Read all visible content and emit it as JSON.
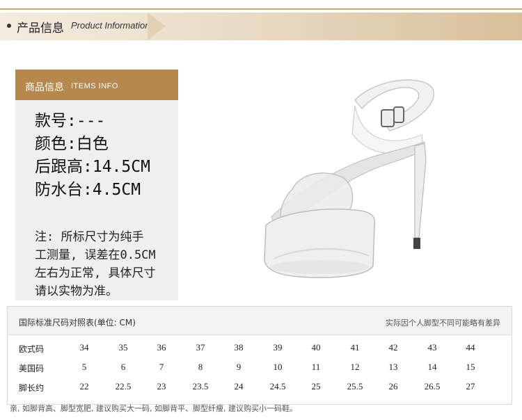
{
  "header": {
    "title_cn": "产品信息",
    "title_en": "Product Information"
  },
  "info": {
    "header_cn": "商品信息",
    "header_en": "ITEMS INFO",
    "specs": [
      "款号:---",
      "颜色:白色",
      "后跟高:14.5CM",
      "防水台:4.5CM"
    ],
    "note_lines": [
      "注: 所标尺寸为纯手",
      "工测量, 误差在0.5CM",
      "左右为正常, 具体尺寸",
      "请以实物为准。"
    ]
  },
  "size_table": {
    "title": "国际标准尺码对照表(单位: CM)",
    "remark": "实际因个人脚型不同可能略有差异",
    "rows": [
      {
        "label": "欧式码",
        "values": [
          "34",
          "35",
          "36",
          "37",
          "38",
          "39",
          "40",
          "41",
          "42",
          "43",
          "44"
        ]
      },
      {
        "label": "美国码",
        "values": [
          "5",
          "6",
          "7",
          "8",
          "9",
          "10",
          "11",
          "12",
          "13",
          "14",
          "15"
        ]
      },
      {
        "label": "脚长约",
        "values": [
          "22",
          "22.5",
          "23",
          "23.5",
          "24",
          "24.5",
          "25",
          "25.5",
          "26",
          "26.5",
          "27"
        ]
      }
    ]
  },
  "footer_note": "亲, 如脚背高、脚型宽肥, 建议购买大一码, 如脚背平、脚型纤瘦, 建议购买小一码鞋。"
}
